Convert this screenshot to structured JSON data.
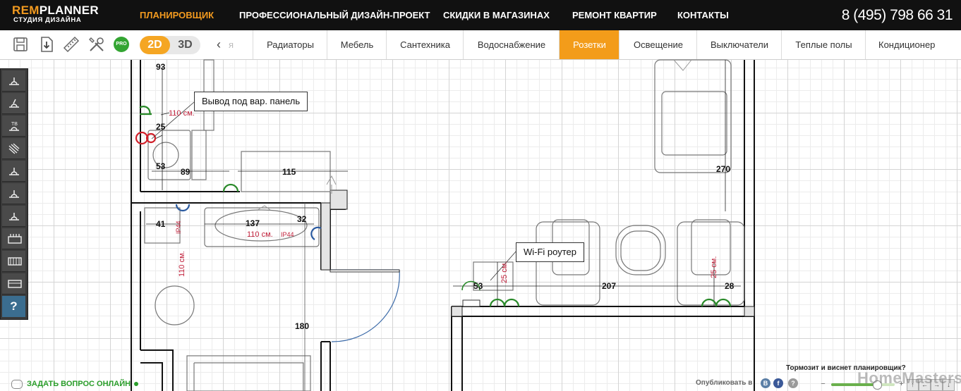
{
  "header": {
    "logo_line1_accent": "REM",
    "logo_line1_rest": "PLANNER",
    "logo_line2": "СТУДИЯ ДИЗАЙНА",
    "nav": [
      {
        "label": "ПЛАНИРОВЩИК",
        "active": true
      },
      {
        "label": "ПРОФЕССИОНАЛЬНЫЙ ДИЗАЙН-ПРОЕКТ",
        "active": false
      },
      {
        "label": "СКИДКИ В МАГАЗИНАХ",
        "active": false
      },
      {
        "label": "РЕМОНТ КВАРТИР",
        "active": false
      },
      {
        "label": "КОНТАКТЫ",
        "active": false
      }
    ],
    "phone": "8 (495) 798 66 31"
  },
  "toolbar": {
    "icons": [
      "save-icon",
      "download-icon",
      "measure-icon",
      "tools-icon",
      "pro-badge-icon"
    ],
    "pro_label": "PRO",
    "view_2d": "2D",
    "view_3d": "3D",
    "tab_prev_arrow": "‹",
    "tab_partial": "я",
    "tabs": [
      {
        "label": "Радиаторы",
        "active": false
      },
      {
        "label": "Мебель",
        "active": false
      },
      {
        "label": "Сантехника",
        "active": false
      },
      {
        "label": "Водоснабжение",
        "active": false
      },
      {
        "label": "Розетки",
        "active": true
      },
      {
        "label": "Освещение",
        "active": false
      },
      {
        "label": "Выключатели",
        "active": false
      },
      {
        "label": "Теплые полы",
        "active": false
      },
      {
        "label": "Кондиционер",
        "active": false
      }
    ]
  },
  "side_tools": {
    "tools": [
      "socket-icon",
      "socket-angled-icon",
      "socket-tv-icon",
      "socket-hand-icon",
      "socket-icon",
      "socket-icon",
      "socket-icon",
      "socket-block-icon",
      "socket-block-icon",
      "socket-block-icon"
    ],
    "help_label": "?"
  },
  "plan": {
    "callouts": {
      "panel_output": "Вывод под вар. панель",
      "wifi_router": "Wi-Fi роутер"
    },
    "dimensions": {
      "d93": "93",
      "d110_top": "110 см.",
      "d25": "25",
      "d53_left": "53",
      "d89": "89",
      "d115": "115",
      "d270": "270",
      "d41": "41",
      "d137": "137",
      "d32": "32",
      "d110_mid": "110 см.",
      "ip44_right": "IP44",
      "ip44_left": "IP44",
      "d110_vertical": "110 см.",
      "d180": "180",
      "d53_right": "53",
      "d25_vert_1": "25 см.",
      "d207": "207",
      "d25_vert_2": "25 см.",
      "d28": "28"
    }
  },
  "footer": {
    "ask_question": "ЗАДАТЬ ВОПРОС ОНЛАЙН",
    "slow_notice": "Тормозит и виснет планировщик?",
    "publish_label": "Опубликовать в",
    "watermark": "HomeMasters.ru",
    "social": [
      {
        "name": "vk-icon",
        "text": "B",
        "color": "#5b7fa6"
      },
      {
        "name": "facebook-icon",
        "text": "f",
        "color": "#3b5998"
      },
      {
        "name": "help-circle-icon",
        "text": "?",
        "color": "#9a9a9a"
      }
    ],
    "zoom_minus": "−",
    "zoom_plus": "+",
    "zoom_level": 0.72,
    "nav_arrows": [
      "↑",
      "←",
      "→",
      "↓"
    ]
  },
  "colors": {
    "accent": "#f39c1a",
    "topbar_bg": "#111111",
    "socket_green": "#2a8a2a",
    "socket_red": "#d0202a",
    "socket_blue": "#2a5aa0",
    "dimension_red": "#c0203a"
  }
}
